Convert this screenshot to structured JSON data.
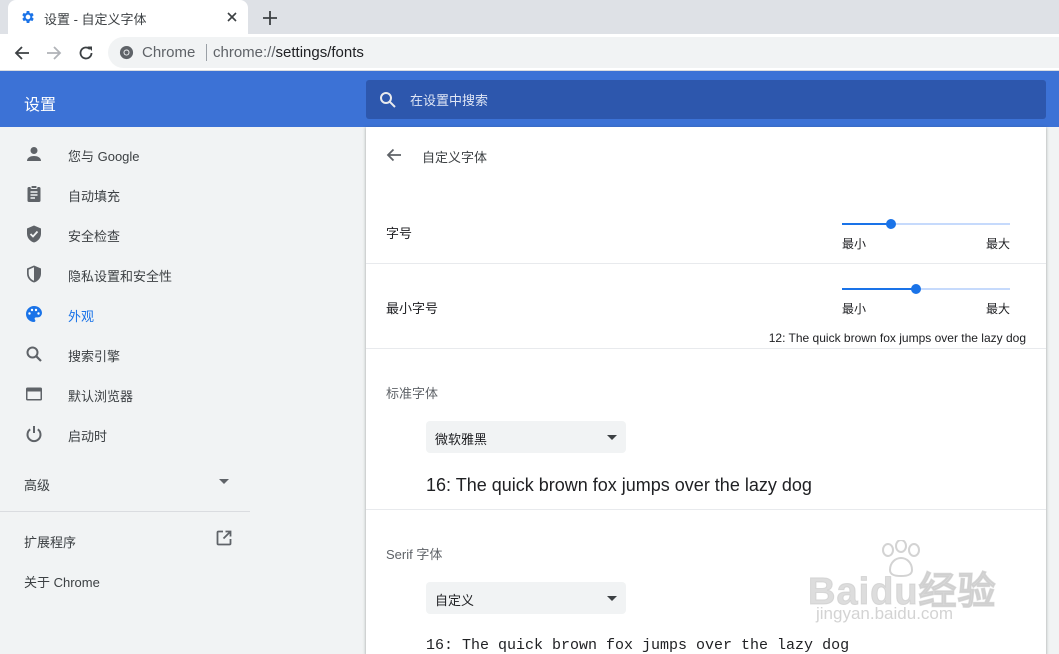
{
  "browser": {
    "tab": {
      "title": "设置 - 自定义字体",
      "favicon": "gear-icon"
    },
    "omnibox": {
      "site": "Chrome",
      "url_scheme": "chrome://",
      "url_rest": "settings/fonts"
    }
  },
  "header": {
    "title": "设置",
    "search": {
      "placeholder": "在设置中搜索",
      "value": ""
    }
  },
  "sidebar": {
    "items": [
      {
        "label": "您与 Google",
        "icon": "person-icon",
        "active": false
      },
      {
        "label": "自动填充",
        "icon": "clipboard-icon",
        "active": false
      },
      {
        "label": "安全检查",
        "icon": "shield-check-icon",
        "active": false
      },
      {
        "label": "隐私设置和安全性",
        "icon": "shield-icon",
        "active": false
      },
      {
        "label": "外观",
        "icon": "palette-icon",
        "active": true
      },
      {
        "label": "搜索引擎",
        "icon": "search-icon",
        "active": false
      },
      {
        "label": "默认浏览器",
        "icon": "browser-icon",
        "active": false
      },
      {
        "label": "启动时",
        "icon": "power-icon",
        "active": false
      }
    ],
    "advanced": "高级",
    "extensions": "扩展程序",
    "about": "关于 Chrome"
  },
  "page": {
    "title": "自定义字体",
    "font_size": {
      "label": "字号",
      "min_label": "最小",
      "max_label": "最大",
      "level": 0.29
    },
    "min_font_size": {
      "label": "最小字号",
      "min_label": "最小",
      "max_label": "最大",
      "level": 0.44,
      "sample": "12: The quick brown fox jumps over the lazy dog"
    },
    "standard_font": {
      "label": "标准字体",
      "value": "微软雅黑",
      "sample": "16: The quick brown fox jumps over the lazy dog"
    },
    "serif_font": {
      "label": "Serif 字体",
      "value": "自定义",
      "sample": "16: The quick brown fox jumps over the lazy dog"
    }
  },
  "watermark": {
    "text": "Baidu经验",
    "sub": "jingyan.baidu.com"
  },
  "colors": {
    "accent": "#1a73e8",
    "header": "#3c72d6",
    "search_bg": "#2d57ad",
    "sidebar_bg": "#f1f3f4"
  }
}
